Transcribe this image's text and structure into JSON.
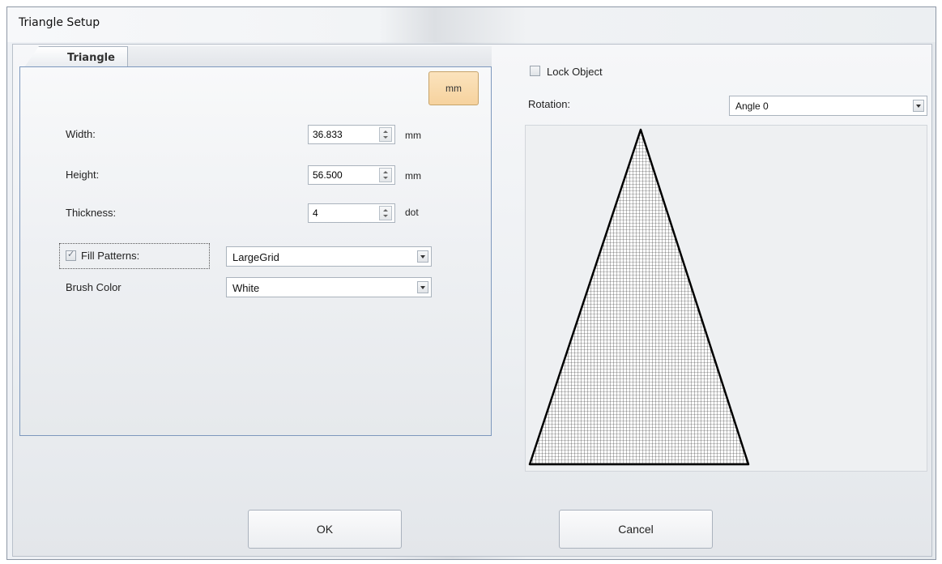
{
  "window": {
    "title": "Triangle Setup"
  },
  "tabs": [
    {
      "label": "Triangle",
      "active": true
    }
  ],
  "unit_button": {
    "label": "mm"
  },
  "fields": {
    "width": {
      "label": "Width:",
      "value": "36.833",
      "unit": "mm"
    },
    "height": {
      "label": "Height:",
      "value": "56.500",
      "unit": "mm"
    },
    "thickness": {
      "label": "Thickness:",
      "value": "4",
      "unit": "dot"
    }
  },
  "fill_patterns": {
    "label": "Fill Patterns:",
    "checked": true,
    "selected": "LargeGrid"
  },
  "brush_color": {
    "label": "Brush Color",
    "selected": "White"
  },
  "lock_object": {
    "label": "Lock Object",
    "checked": false
  },
  "rotation": {
    "label": "Rotation:",
    "selected": "Angle 0"
  },
  "preview": {
    "shape": "triangle",
    "pattern": "LargeGrid",
    "fill_color": "#ffffff",
    "stroke_color": "#000000"
  },
  "buttons": {
    "ok": "OK",
    "cancel": "Cancel"
  },
  "colors": {
    "unit_button_bg": "#f6d29e",
    "panel_border": "#7d98bd"
  }
}
